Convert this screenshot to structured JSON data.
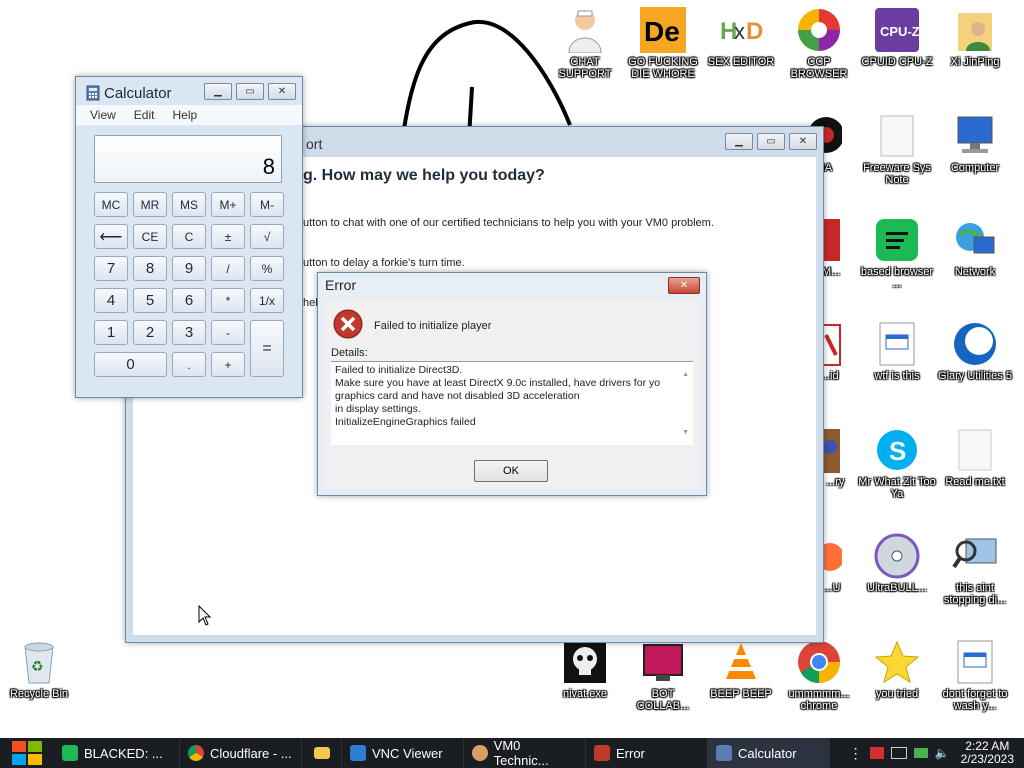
{
  "desktop": {
    "icons": [
      {
        "label": "CHAT SUPPORT",
        "icon": "doctor-icon"
      },
      {
        "label": "GO FUCKING DIE WHORE",
        "icon": "de-logo-icon"
      },
      {
        "label": "SEX EDITOR",
        "icon": "hxd-icon"
      },
      {
        "label": "CCP BROWSER",
        "icon": "browser-icon"
      },
      {
        "label": "CPUID CPU-Z",
        "icon": "cpuz-icon"
      },
      {
        "label": "Xi JinPing",
        "icon": "user-folder-icon"
      },
      {
        "label": "OPIA",
        "icon": "app-icon"
      },
      {
        "label": "Freeware Sys Note",
        "icon": "document-icon"
      },
      {
        "label": "Computer",
        "icon": "computer-icon"
      },
      {
        "label": "YA DM...",
        "icon": "app-icon"
      },
      {
        "label": "based browser ...",
        "icon": "chat-icon"
      },
      {
        "label": "Network",
        "icon": "network-icon"
      },
      {
        "label": "dan ...id",
        "icon": "app-icon"
      },
      {
        "label": "wtf is this",
        "icon": "document-icon"
      },
      {
        "label": "Glary Utilities 5",
        "icon": "glary-icon"
      },
      {
        "label": "...yyy) ...ry",
        "icon": "app-icon"
      },
      {
        "label": "Mr What Zit Too Ya",
        "icon": "skype-icon"
      },
      {
        "label": "Read me.txt",
        "icon": "text-file-icon"
      },
      {
        "label": "FOX ...U",
        "icon": "firefox-icon"
      },
      {
        "label": "UltraBULL...",
        "icon": "disc-icon"
      },
      {
        "label": "this aint stopping di...",
        "icon": "magnifier-computer-icon"
      },
      {
        "label": "nivat.exe",
        "icon": "skull-icon"
      },
      {
        "label": "BOT COLLAB...",
        "icon": "monitor-icon"
      },
      {
        "label": "BEEP BEEP",
        "icon": "vlc-icon"
      },
      {
        "label": "ummmmm... chrome",
        "icon": "chrome-icon"
      },
      {
        "label": "you tried",
        "icon": "star-icon"
      },
      {
        "label": "dont forget to wash y...",
        "icon": "document-icon"
      },
      {
        "label": "Recycle Bin",
        "icon": "recycle-bin-icon"
      }
    ]
  },
  "calculator": {
    "title": "Calculator",
    "menu": [
      "View",
      "Edit",
      "Help"
    ],
    "display": "8",
    "buttons": {
      "mc": "MC",
      "mr": "MR",
      "ms": "MS",
      "mplus": "M+",
      "mminus": "M-",
      "back": "⟵",
      "ce": "CE",
      "c": "C",
      "plusminus": "±",
      "sqrt": "√",
      "n7": "7",
      "n8": "8",
      "n9": "9",
      "div": "/",
      "pct": "%",
      "n4": "4",
      "n5": "5",
      "n6": "6",
      "mul": "*",
      "recip": "1/x",
      "n1": "1",
      "n2": "2",
      "n3": "3",
      "sub": "-",
      "eq": "=",
      "n0": "0",
      "dot": ".",
      "add": "+"
    }
  },
  "support_window": {
    "title": "ort",
    "heading": "g. How may we help you today?",
    "line1": "utton to chat with one of our certified technicians to help you with your VM0 problem.",
    "line2": "utton to delay a forkie's turn time.",
    "line3": "help"
  },
  "error_dialog": {
    "title": "Error",
    "message": "Failed to initialize player",
    "details_label": "Details:",
    "details_lines": [
      "Failed to initialize Direct3D.",
      "Make sure you have at least DirectX 9.0c installed, have drivers for yo",
      "graphics card and have not disabled 3D acceleration",
      "in display settings.",
      "InitializeEngineGraphics failed"
    ],
    "ok_label": "OK"
  },
  "taskbar": {
    "items": [
      {
        "label": "BLACKED: ...",
        "color": "#1db954"
      },
      {
        "label": "Cloudflare - ...",
        "color": "#4285f4"
      },
      {
        "label": "",
        "color": "#f2c94c"
      },
      {
        "label": "VNC Viewer",
        "color": "#2d7dd2"
      },
      {
        "label": "VM0 Technic...",
        "color": "#d9a066"
      },
      {
        "label": "Error",
        "color": "#c0392b"
      },
      {
        "label": "Calculator",
        "color": "#5b7db1"
      }
    ],
    "time": "2:22 AM",
    "date": "2/23/2023"
  },
  "colors": {
    "error_red": "#c0392b",
    "accent": "#2d7dd2"
  }
}
